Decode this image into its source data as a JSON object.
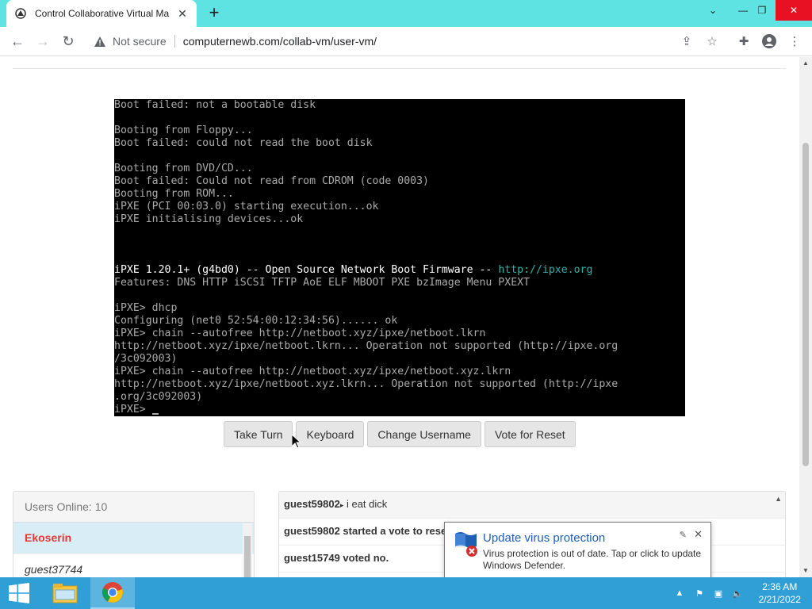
{
  "browser": {
    "tab_title": "Control Collaborative Virtual Ma",
    "not_secure_label": "Not secure",
    "url": "computernewb.com/collab-vm/user-vm/"
  },
  "vm": {
    "lines": [
      {
        "text": "Boot failed: not a bootable disk",
        "style": ""
      },
      {
        "text": "",
        "style": ""
      },
      {
        "text": "Booting from Floppy...",
        "style": ""
      },
      {
        "text": "Boot failed: could not read the boot disk",
        "style": ""
      },
      {
        "text": "",
        "style": ""
      },
      {
        "text": "Booting from DVD/CD...",
        "style": ""
      },
      {
        "text": "Boot failed: Could not read from CDROM (code 0003)",
        "style": ""
      },
      {
        "text": "Booting from ROM...",
        "style": ""
      },
      {
        "text": "iPXE (PCI 00:03.0) starting execution...ok",
        "style": ""
      },
      {
        "text": "iPXE initialising devices...ok",
        "style": ""
      },
      {
        "text": "",
        "style": ""
      },
      {
        "text": "",
        "style": ""
      },
      {
        "text": "",
        "style": ""
      },
      {
        "text": "iPXE 1.20.1+ (g4bd0) -- Open Source Network Boot Firmware -- ",
        "style": "bold",
        "link": "http://ipxe.org"
      },
      {
        "text": "Features: DNS HTTP iSCSI TFTP AoE ELF MBOOT PXE bzImage Menu PXEXT",
        "style": ""
      },
      {
        "text": "",
        "style": ""
      },
      {
        "text": "iPXE> dhcp",
        "style": ""
      },
      {
        "text": "Configuring (net0 52:54:00:12:34:56)...... ok",
        "style": ""
      },
      {
        "text": "iPXE> chain --autofree http://netboot.xyz/ipxe/netboot.lkrn",
        "style": ""
      },
      {
        "text": "http://netboot.xyz/ipxe/netboot.lkrn... Operation not supported (http://ipxe.org",
        "style": ""
      },
      {
        "text": "/3c092003)",
        "style": ""
      },
      {
        "text": "iPXE> chain --autofree http://netboot.xyz/ipxe/netboot.xyz.lkrn",
        "style": ""
      },
      {
        "text": "http://netboot.xyz/ipxe/netboot.xyz.lkrn... Operation not supported (http://ipxe",
        "style": ""
      },
      {
        "text": ".org/3c092003)",
        "style": ""
      },
      {
        "text": "iPXE> ",
        "style": "",
        "cursor": true
      }
    ]
  },
  "controls": {
    "take_turn": "Take Turn",
    "keyboard": "Keyboard",
    "change_username": "Change Username",
    "vote_reset": "Vote for Reset"
  },
  "users": {
    "header": "Users Online: 10",
    "list": [
      "Ekoserin",
      "guest37744"
    ]
  },
  "chat": {
    "messages": [
      {
        "user": "guest59802",
        "arrow": "▸",
        "text": " i eat dick"
      },
      {
        "user": "",
        "arrow": "",
        "text": "guest59802 started a vote to rese"
      },
      {
        "user": "",
        "arrow": "",
        "text": "guest15749 voted no."
      }
    ]
  },
  "notification": {
    "title": "Update virus protection",
    "body": "Virus protection is out of date. Tap or click to update Windows Defender."
  },
  "taskbar": {
    "time": "2:36 AM",
    "date": "2/21/2022"
  },
  "colors": {
    "tabstrip": "#5fe2e2",
    "taskbar": "#2f9fd6",
    "active_user": "#e53935",
    "link_cyan": "#2bb5a8"
  }
}
